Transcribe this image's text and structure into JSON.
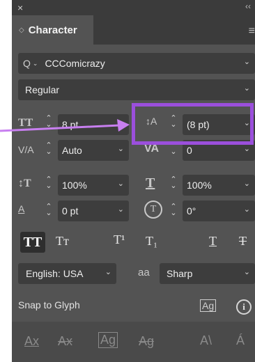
{
  "window": {
    "close_glyph": "×",
    "collapse_glyph": "‹‹"
  },
  "panel": {
    "tab_title": "Character",
    "tab_chevron": "◇",
    "menu_glyph": "≡"
  },
  "font": {
    "search_glyph": "Q",
    "family": "CCComicrazy",
    "style": "Regular"
  },
  "size": {
    "icon": "TT",
    "value": "8 pt"
  },
  "leading": {
    "icon": "↕A",
    "value": "(8 pt)"
  },
  "kerning": {
    "icon": "V/A",
    "value": "Auto"
  },
  "tracking": {
    "icon": "VA",
    "value": "0"
  },
  "vscale": {
    "icon": "↕T",
    "value": "100%"
  },
  "hscale": {
    "icon": "T",
    "value": "100%"
  },
  "baseline": {
    "icon": "A",
    "value": "0 pt"
  },
  "rotation": {
    "icon": "T",
    "value": "0°"
  },
  "type_buttons": {
    "all_caps": "TT",
    "small_caps": "Tт",
    "superscript": "T¹",
    "subscript": "T₁",
    "underline": "T",
    "strike": "T"
  },
  "language": {
    "value": "English: USA"
  },
  "antialias": {
    "icon": "aa",
    "value": "Sharp"
  },
  "snap": {
    "label": "Snap to Glyph",
    "info_glyph": "i"
  },
  "colors": {
    "panel": "#535353",
    "field": "#3d3d3d",
    "highlight": "#9b4fdc",
    "arrow": "#c87ff0"
  }
}
